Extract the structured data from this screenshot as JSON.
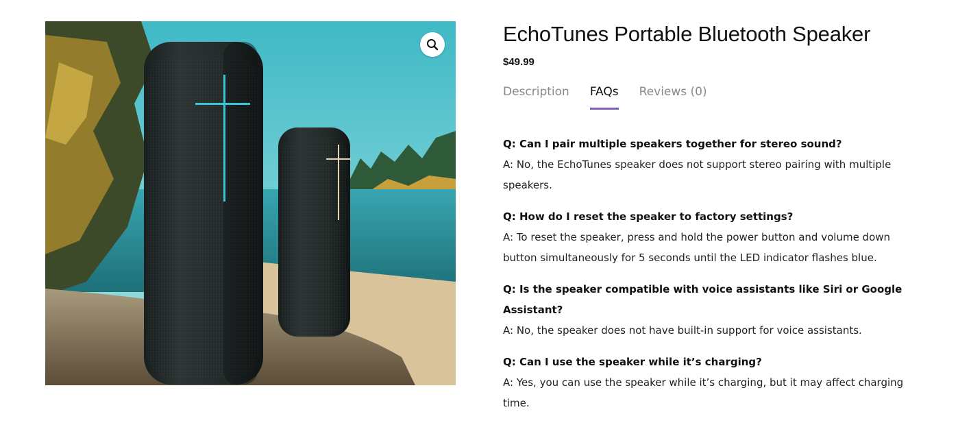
{
  "product": {
    "title": "EchoTunes Portable Bluetooth Speaker",
    "price": "$49.99",
    "image_alt": "Two black cylindrical speakers on a rock by a lake",
    "zoom_icon": "magnifier-icon"
  },
  "tabs": [
    {
      "label": "Description",
      "active": false
    },
    {
      "label": "FAQs",
      "active": true
    },
    {
      "label": "Reviews (0)",
      "active": false
    }
  ],
  "accent_color": "#7e5fb5",
  "faqs": [
    {
      "q": "Q: Can I pair multiple speakers together for stereo sound?",
      "a": "A: No, the EchoTunes speaker does not support stereo pairing with multiple speakers."
    },
    {
      "q": "Q: How do I reset the speaker to factory settings?",
      "a": "A: To reset the speaker, press and hold the power button and volume down button simultaneously for 5 seconds until the LED indicator flashes blue."
    },
    {
      "q": "Q: Is the speaker compatible with voice assistants like Siri or Google Assistant?",
      "a": "A: No, the speaker does not have built-in support for voice assistants."
    },
    {
      "q": "Q: Can I use the speaker while it’s charging?",
      "a": "A: Yes, you can use the speaker while it’s charging, but it may affect charging time."
    }
  ]
}
